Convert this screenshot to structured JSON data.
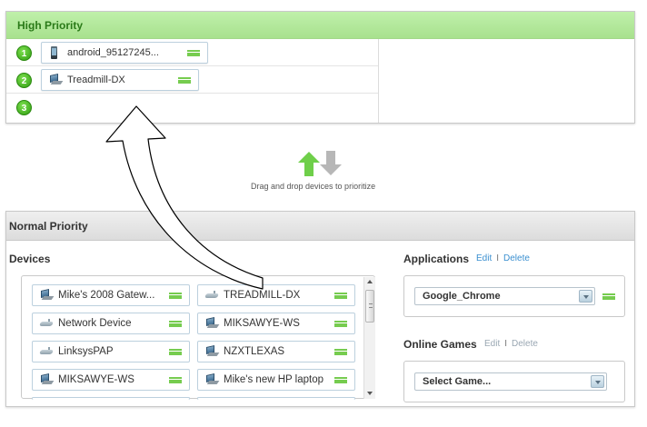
{
  "high_priority": {
    "title": "High Priority",
    "slots": [
      {
        "number": "1",
        "device": {
          "label": "android_95127245...",
          "icon": "phone-icon"
        }
      },
      {
        "number": "2",
        "device": {
          "label": "Treadmill-DX",
          "icon": "laptop-icon"
        }
      },
      {
        "number": "3",
        "device": null
      }
    ]
  },
  "drag_hint": "Drag and drop devices to prioritize",
  "normal_priority": {
    "title": "Normal Priority",
    "devices": {
      "title": "Devices",
      "items": [
        {
          "label": "Mike's 2008 Gatew...",
          "icon": "laptop-icon"
        },
        {
          "label": "TREADMILL-DX",
          "icon": "router-icon"
        },
        {
          "label": "Network Device",
          "icon": "router-icon"
        },
        {
          "label": "MIKSAWYE-WS",
          "icon": "laptop-icon"
        },
        {
          "label": "LinksysPAP",
          "icon": "router-icon"
        },
        {
          "label": "NZXTLEXAS",
          "icon": "laptop-icon"
        },
        {
          "label": "MIKSAWYE-WS",
          "icon": "laptop-icon"
        },
        {
          "label": "Mike's new HP laptop",
          "icon": "laptop-icon"
        }
      ]
    },
    "applications": {
      "title": "Applications",
      "edit": "Edit",
      "delete": "Delete",
      "separator": "I",
      "selected": "Google_Chrome"
    },
    "online_games": {
      "title": "Online Games",
      "edit": "Edit",
      "delete": "Delete",
      "separator": "I",
      "selected": "Select Game..."
    }
  },
  "colors": {
    "accent_green": "#76cc4f",
    "header_green": "#a8e18e",
    "link_blue": "#3a8fd0"
  }
}
